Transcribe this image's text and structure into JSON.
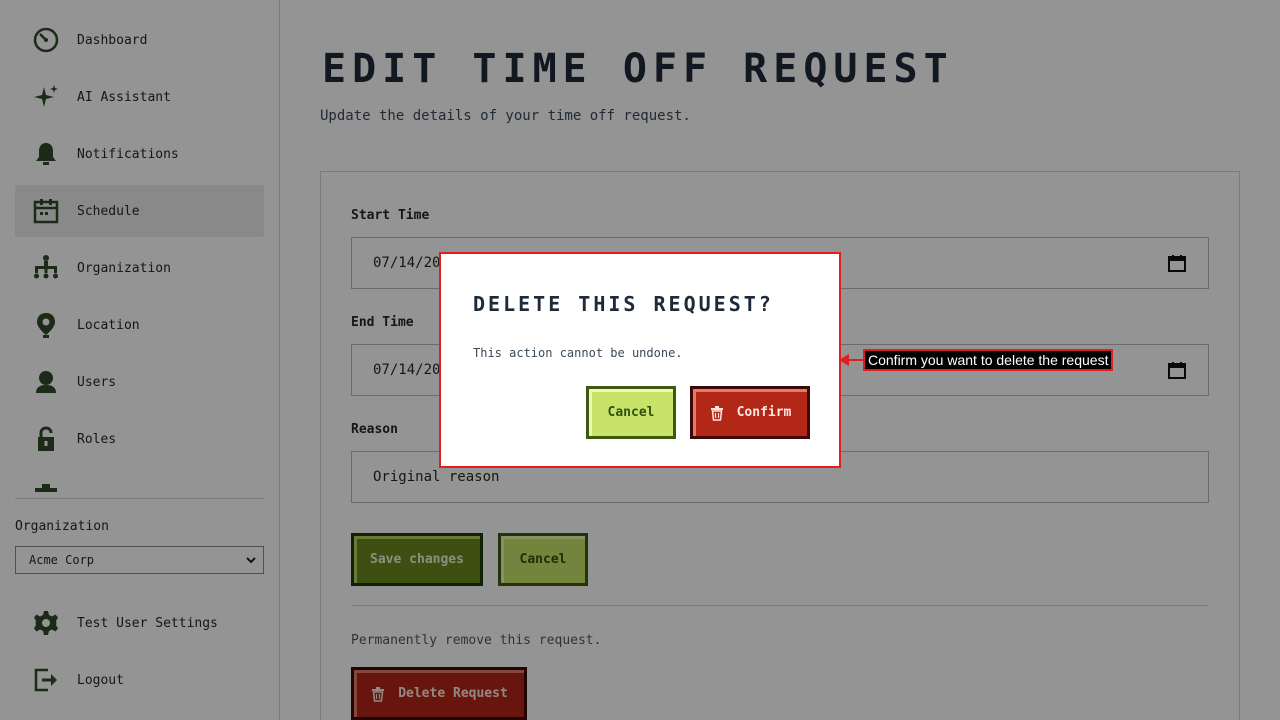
{
  "sidebar": {
    "items": [
      {
        "label": "Dashboard",
        "icon": "dashboard-icon",
        "active": false
      },
      {
        "label": "AI Assistant",
        "icon": "sparkle-icon",
        "active": false
      },
      {
        "label": "Notifications",
        "icon": "bell-icon",
        "active": false
      },
      {
        "label": "Schedule",
        "icon": "calendar-icon",
        "active": true
      },
      {
        "label": "Organization",
        "icon": "org-chart-icon",
        "active": false
      },
      {
        "label": "Location",
        "icon": "location-pin-icon",
        "active": false
      },
      {
        "label": "Users",
        "icon": "user-icon",
        "active": false
      },
      {
        "label": "Roles",
        "icon": "lock-icon",
        "active": false
      }
    ],
    "organization_label": "Organization",
    "organization_selected": "Acme Corp",
    "settings_label": "Test User Settings",
    "logout_label": "Logout"
  },
  "page": {
    "title": "EDIT TIME OFF REQUEST",
    "subtitle": "Update the details of your time off request."
  },
  "form": {
    "start_label": "Start Time",
    "start_value": "07/14/20",
    "end_label": "End Time",
    "end_value": "07/14/20",
    "reason_label": "Reason",
    "reason_value": "Original reason",
    "save_label": "Save changes",
    "cancel_label": "Cancel",
    "danger_text": "Permanently remove this request.",
    "delete_label": "Delete Request"
  },
  "modal": {
    "title": "DELETE THIS REQUEST?",
    "text": "This action cannot be undone.",
    "cancel_label": "Cancel",
    "confirm_label": "Confirm"
  },
  "annotation": {
    "text": "Confirm you want to delete the request"
  },
  "colors": {
    "accent_green": "#6b8a1e",
    "light_green": "#c7e36a",
    "danger_red": "#b32717",
    "highlight_red": "#e11d1d"
  }
}
